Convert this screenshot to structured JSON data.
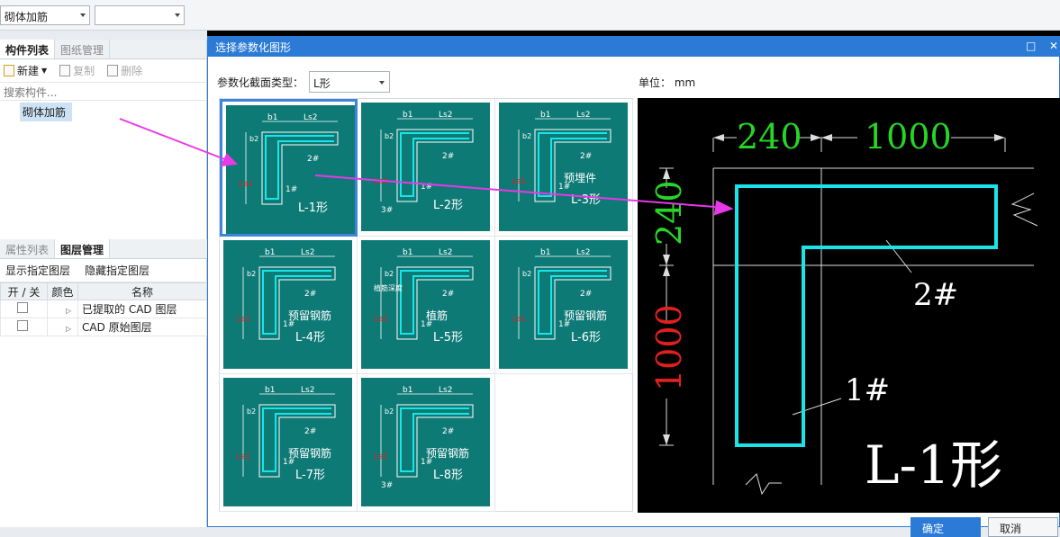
{
  "top": {
    "combo1": "砌体加筋",
    "combo2": ""
  },
  "left": {
    "tabs": [
      "构件列表",
      "图纸管理"
    ],
    "toolbar": {
      "new": "新建",
      "copy": "复制",
      "delete": "删除"
    },
    "search_placeholder": "搜索构件...",
    "tree_item": "砌体加筋",
    "tabs2": [
      "属性列表",
      "图层管理"
    ],
    "show_layer": "显示指定图层",
    "hide_layer": "隐藏指定图层",
    "table_headers": [
      "开 / 关",
      "颜色",
      "名称"
    ],
    "layers": [
      "已提取的 CAD 图层",
      "CAD 原始图层"
    ]
  },
  "dialog": {
    "title": "选择参数化图形",
    "type_label": "参数化截面类型：",
    "type_value": "L形",
    "unit_label": "单位：",
    "unit_value": "mm",
    "ok": "确定",
    "cancel": "取消",
    "thumbs": [
      {
        "name": "L-1形",
        "extra": ""
      },
      {
        "name": "L-2形",
        "extra": ""
      },
      {
        "name": "L-3形",
        "extra": "预埋件"
      },
      {
        "name": "L-4形",
        "extra": "预留钢筋"
      },
      {
        "name": "L-5形",
        "extra": "植筋"
      },
      {
        "name": "L-6形",
        "extra": "预留钢筋"
      },
      {
        "name": "L-7形",
        "extra": "预留钢筋"
      },
      {
        "name": "L-8形",
        "extra": "预留钢筋"
      }
    ],
    "thumb_labels": {
      "b1": "b1",
      "b2": "b2",
      "ls2": "Ls2",
      "la1": "La1",
      "r1": "1#",
      "r2": "2#",
      "r3": "3#",
      "anchor": "植筋深度"
    },
    "preview": {
      "dim_top1": "240",
      "dim_top2": "1000",
      "dim_left1": "240",
      "dim_left2": "1000",
      "r2": "2#",
      "r1": "1#",
      "name": "L-1形"
    }
  },
  "colors": {
    "teal": "#0e7a76",
    "cyan": "#18e5e8",
    "green": "#28d428",
    "red": "#e02020",
    "accent": "#2b7bd6",
    "arrow": "#e838e8"
  }
}
